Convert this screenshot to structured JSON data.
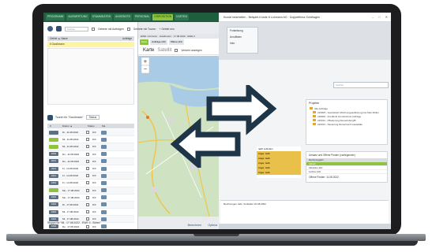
{
  "left_app": {
    "nav_tabs": [
      "PROGRAMM",
      "AUSWERTUNG",
      "STAMMDATEN",
      "ANGEBOTE",
      "PERSONAL",
      "DISPOSITION",
      "KARTEN"
    ],
    "active_tab_index": 5,
    "search_placeholder": "Suchen",
    "filter_label_1": "Gebiete mit Aufträgen",
    "filter_label_2": "Gebiete mit Touren",
    "add_area_label": "+ Gebiet neu",
    "area_header": "Gebiet ▲ Name",
    "area_header_right": "Aufträge",
    "selected_area": "6    Gaußmann",
    "tour_title": "Touren für \"Gaußmann\"",
    "tour_status_label": "Status",
    "tour_columns": [
      "#",
      "Datum ▲",
      "Status",
      "Ma."
    ],
    "tours": [
      {
        "badge": "",
        "color": "#ffffff",
        "date": "Di., 11.08.2022",
        "text": "D/F"
      },
      {
        "badge": "",
        "color": "#8fc33f",
        "date": "Mi., 11.08.2022",
        "text": "D/F"
      },
      {
        "badge": "",
        "color": "#8fc33f",
        "date": "Mi., 11.08.2022",
        "text": "D/F"
      },
      {
        "badge": "4063",
        "color": "#ffffff",
        "date": "Do., 11.08.2022",
        "text": "D/F"
      },
      {
        "badge": "3521",
        "color": "#ffffff",
        "date": "Do., 11.08.2022",
        "text": "D/F"
      },
      {
        "badge": "4411",
        "color": "#ffffff",
        "date": "Fr., 14.08.2022",
        "text": "D/F"
      },
      {
        "badge": "3412",
        "color": "#ffffff",
        "date": "Fr., 14.08.2022",
        "text": "D/F"
      },
      {
        "badge": "4361",
        "color": "#ffffff",
        "date": "Fr., 14.08.2022",
        "text": "D/F"
      },
      {
        "badge": "",
        "color": "#8fc33f",
        "date": "Mo., 17.08.2022",
        "text": "D/F"
      },
      {
        "badge": "3361",
        "color": "#ffffff",
        "date": "Mo., 17.08.2022",
        "text": "D/F"
      },
      {
        "badge": "4364",
        "color": "#ffffff",
        "date": "Di., 17.08.2022",
        "text": "D/F"
      },
      {
        "badge": "3363",
        "color": "#ffffff",
        "date": "Mi., 17.08.2022",
        "text": "D/F"
      },
      {
        "badge": "4361",
        "color": "#ffffff",
        "date": "Mi., 17.08.2022",
        "text": "D/F"
      },
      {
        "badge": "4364",
        "color": "#ffffff",
        "date": "Do., 17.08.2022",
        "text": "D/F"
      }
    ],
    "footer_text": "Stopps für \"Mi., 17.08.2022 - EWE 3 - Böhm\"",
    "footer_btn_1": "Berechnen",
    "footer_btn_2": "Optima"
  },
  "map_panel": {
    "tabs_text": "EWE: Umzetzer · Gaußmann · 17.08.2022 · EWE 3",
    "sub_tabs": [
      "Karte",
      "Aufträge (23)",
      "Offene (23)"
    ],
    "view_karte": "Karte",
    "view_sat": "Satellit",
    "label_show": "Verkehr anzeigen"
  },
  "right_app": {
    "title": "Kunde bearbeiten - Beispiel-Kunde 8 Lohmann AG · Doppelfirma Goldhagen",
    "ribbon_label_1": "Fortsetzung",
    "ribbon_label_2": "Anruflisten",
    "ribbon_label_3": "Infor",
    "search_placeholder": "Suchen",
    "projects_title": "Projekte",
    "projects": [
      "Alle Aufträge",
      "216005 - Jacobsdorf (Wohnungsauflösung) bei Max Müller",
      "218006 - Friedhofs Grundschutz Aufträge",
      "220012 - Pflastervog Reinertsberg/B",
      "220013 - Sanierung Reinerhoch Gaststätte"
    ],
    "greenlist": [
      "nach Lohmann",
      "Anger, Gelb",
      "Anger, Gelb",
      "Anger, Gelb",
      "Anger, Gelb",
      "Anger, Gelb"
    ],
    "umsatz_title": "Umsatz und Offene Posten (vorliegender)",
    "umsatz_header": "Rechnungsjahr",
    "umsatz_rows": [
      "Aktuell",
      "Aktuelles Jahr",
      "Letztes Jahr"
    ],
    "offene_posten": "Offene Posten: 11.08.2022",
    "bottom_text": "Rechnungen Jahr, Verkäufer 22.08.2022"
  }
}
